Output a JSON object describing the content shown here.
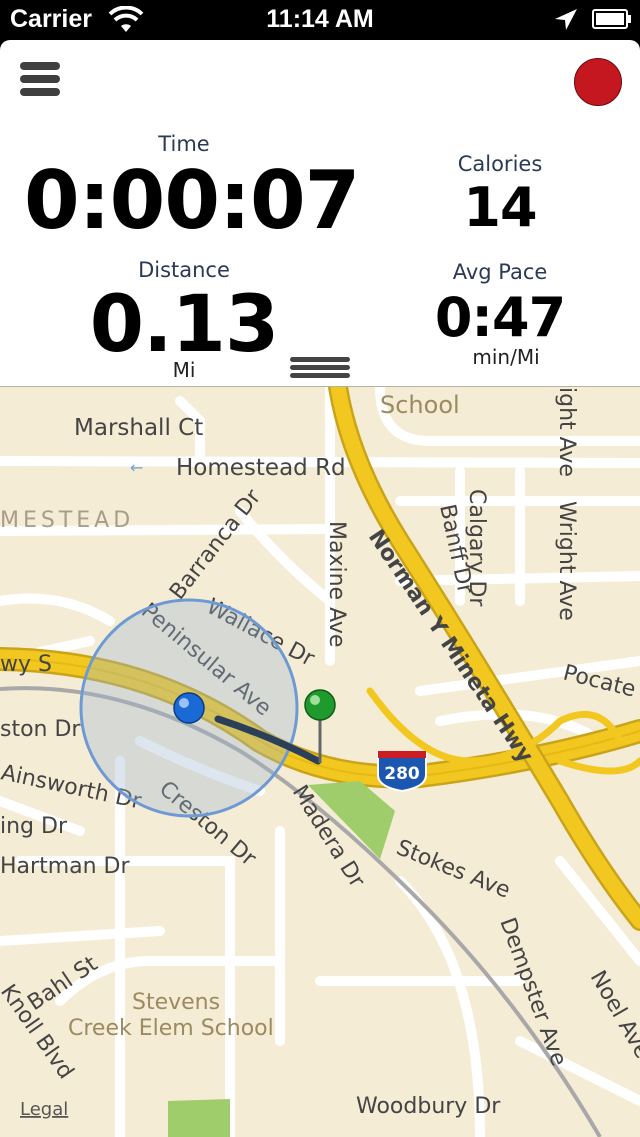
{
  "status_bar": {
    "carrier": "Carrier",
    "time": "11:14 AM"
  },
  "workout": {
    "time": {
      "label": "Time",
      "value": "0:00:07"
    },
    "calories": {
      "label": "Calories",
      "value": "14"
    },
    "distance": {
      "label": "Distance",
      "value": "0.13",
      "unit": "Mi"
    },
    "avg_pace": {
      "label": "Avg Pace",
      "value": "0:47",
      "unit": "min/Mi"
    }
  },
  "map": {
    "legal": "Legal",
    "highway_shield": "280",
    "labels": {
      "school_top": "School",
      "marshall": "Marshall Ct",
      "homestead": "Homestead Rd",
      "mestead": "MESTEAD",
      "barranca": "Barranca Dr",
      "maxine": "Maxine Ave",
      "norman": "Norman Y Mineta Hwy",
      "calgary": "Calgary Dr",
      "banff": "Banff Dr",
      "wright": "Wright Ave",
      "wright_top": "ight Ave",
      "wallace": "Wallace Dr",
      "peninsular": "Peninsular Ave",
      "hwy_s": "wy S",
      "pocate": "Pocate",
      "ston": "ston Dr",
      "ainsworth": "Ainsworth Dr",
      "ing": "ing Dr",
      "hartman": "Hartman Dr",
      "creston": "Creston Dr",
      "madera": "Madera Dr",
      "stokes": "Stokes Ave",
      "dempster": "Dempster Ave",
      "noel": "Noel Ave",
      "bahl": "Bahl St",
      "knoll": "Knoll Blvd",
      "stevens1": "Stevens",
      "stevens2": "Creek Elem School",
      "woodbury": "Woodbury Dr"
    }
  },
  "colors": {
    "record": "#c4171f",
    "map_bg": "#f5ecd6",
    "highway": "#f2c820",
    "accuracy_circle": "#7fa6d6"
  },
  "icons": [
    "wifi-icon",
    "location-arrow-icon",
    "battery-icon",
    "menu-icon",
    "record-icon",
    "drag-handle-icon",
    "current-location-icon",
    "start-pin-icon"
  ]
}
